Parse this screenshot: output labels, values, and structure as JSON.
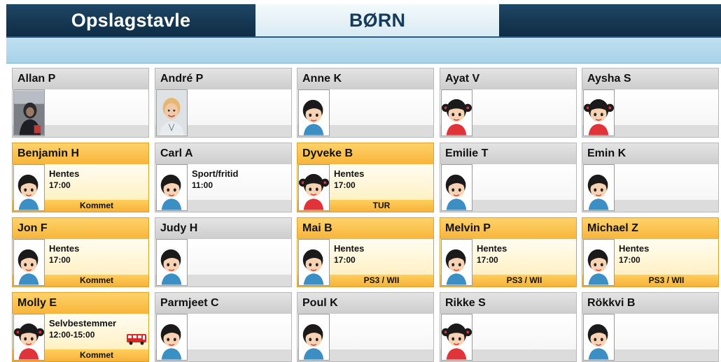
{
  "tabs": {
    "left": "Opslagstavle",
    "center": "BØRN",
    "right": ""
  },
  "children": [
    {
      "name": "Allan P",
      "avatar": "photo-dark",
      "status": "",
      "time": "",
      "footer": "",
      "highlight": false
    },
    {
      "name": "André P",
      "avatar": "photo-blond",
      "status": "",
      "time": "",
      "footer": "",
      "highlight": false
    },
    {
      "name": "Anne K",
      "avatar": "boy",
      "status": "",
      "time": "",
      "footer": "",
      "highlight": false
    },
    {
      "name": "Ayat V",
      "avatar": "girl",
      "status": "",
      "time": "",
      "footer": "",
      "highlight": false
    },
    {
      "name": "Aysha S",
      "avatar": "girl",
      "status": "",
      "time": "",
      "footer": "",
      "highlight": false
    },
    {
      "name": "Benjamin H",
      "avatar": "boy",
      "status": "Hentes",
      "time": "17:00",
      "footer": "Kommet",
      "highlight": true
    },
    {
      "name": "Carl A",
      "avatar": "boy",
      "status": "Sport/fritid",
      "time": "11:00",
      "footer": "",
      "highlight": false
    },
    {
      "name": "Dyveke B",
      "avatar": "girl",
      "status": "Hentes",
      "time": "17:00",
      "footer": "TUR",
      "highlight": true
    },
    {
      "name": "Emilie T",
      "avatar": "boy",
      "status": "",
      "time": "",
      "footer": "",
      "highlight": false
    },
    {
      "name": "Emin K",
      "avatar": "boy",
      "status": "",
      "time": "",
      "footer": "",
      "highlight": false
    },
    {
      "name": "Jon F",
      "avatar": "boy",
      "status": "Hentes",
      "time": "17:00",
      "footer": "Kommet",
      "highlight": true
    },
    {
      "name": "Judy H",
      "avatar": "boy",
      "status": "",
      "time": "",
      "footer": "",
      "highlight": false
    },
    {
      "name": "Mai B",
      "avatar": "boy",
      "status": "Hentes",
      "time": "17:00",
      "footer": "PS3 / WII",
      "highlight": true
    },
    {
      "name": "Melvin P",
      "avatar": "boy",
      "status": "Hentes",
      "time": "17:00",
      "footer": "PS3 / WII",
      "highlight": true
    },
    {
      "name": "Michael Z",
      "avatar": "boy",
      "status": "Hentes",
      "time": "17:00",
      "footer": "PS3 / WII",
      "highlight": true
    },
    {
      "name": "Molly E",
      "avatar": "girl",
      "status": "Selvbestemmer",
      "time": "12:00-15:00",
      "footer": "Kommet",
      "highlight": true,
      "bus": true
    },
    {
      "name": "Parmjeet C",
      "avatar": "boy",
      "status": "",
      "time": "",
      "footer": "",
      "highlight": false
    },
    {
      "name": "Poul K",
      "avatar": "boy",
      "status": "",
      "time": "",
      "footer": "",
      "highlight": false
    },
    {
      "name": "Rikke S",
      "avatar": "girl",
      "status": "",
      "time": "",
      "footer": "",
      "highlight": false
    },
    {
      "name": "Rökkvi B",
      "avatar": "boy",
      "status": "",
      "time": "",
      "footer": "",
      "highlight": false
    }
  ],
  "colors": {
    "tab_dark": "#163955",
    "tab_active_text": "#163a5c",
    "highlight": "#f7b53a",
    "subbar": "#a8d2e8"
  }
}
